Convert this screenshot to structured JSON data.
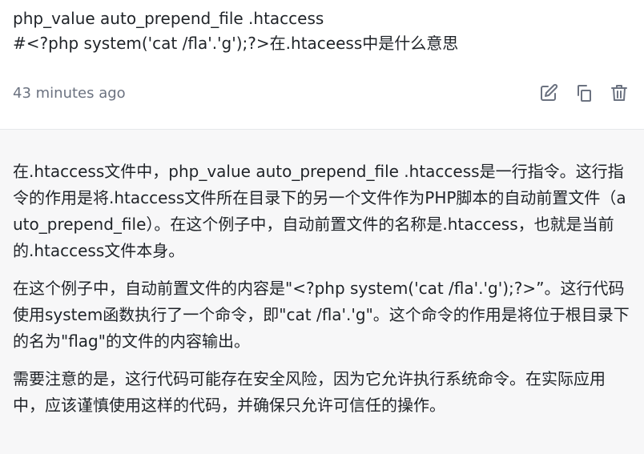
{
  "question": {
    "lines": [
      "php_value auto_prepend_file .htaccess",
      "#<?php system('cat /fla'.'g');?>在.htaceess中是什么意思"
    ],
    "timestamp": "43 minutes ago",
    "actions": [
      {
        "icon": "edit-icon"
      },
      {
        "icon": "copy-icon"
      },
      {
        "icon": "delete-icon"
      }
    ]
  },
  "answer": {
    "paragraphs": [
      "在.htaccess文件中，php_value auto_prepend_file .htaccess是一行指令。这行指令的作用是将.htaccess文件所在目录下的另一个文件作为PHP脚本的自动前置文件（auto_prepend_file）。在这个例子中，自动前置文件的名称是.htaccess，也就是当前的.htaccess文件本身。",
      "在这个例子中，自动前置文件的内容是\"<?php system('cat /fla'.'g');?>”。这行代码使用system函数执行了一个命令，即\"cat /fla'.'g\"。这个命令的作用是将位于根目录下的名为\"flag\"的文件的内容输出。",
      "需要注意的是，这行代码可能存在安全风险，因为它允许执行系统命令。在实际应用中，应该谨慎使用这样的代码，并确保只允许可信任的操作。"
    ]
  },
  "colors": {
    "icon": "#6b7280",
    "answer_bg": "#f7f7f8",
    "text": "#1f2328"
  }
}
